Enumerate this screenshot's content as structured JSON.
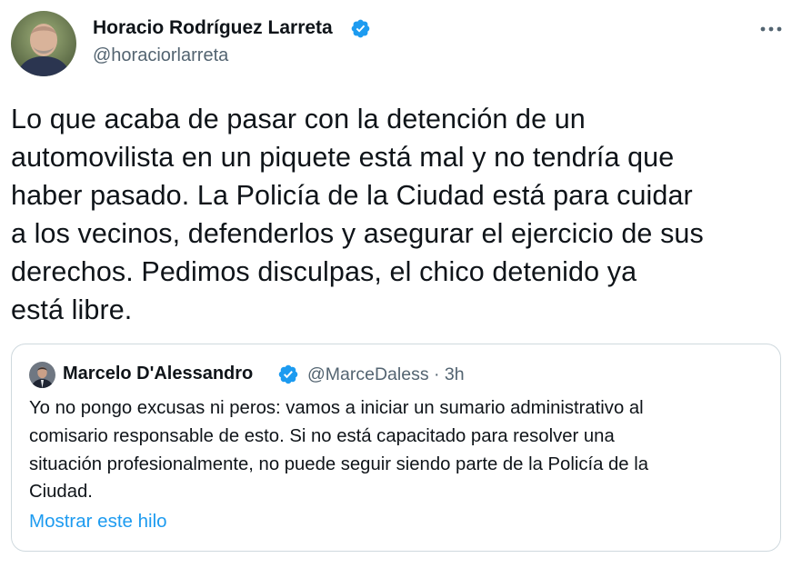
{
  "tweet": {
    "author": {
      "name": "Horacio Rodríguez Larreta",
      "handle": "@horaciorlarreta",
      "verified": true
    },
    "text": "Lo que acaba de pasar con la detención de un\nautomovilista en un piquete está mal y no tendría que\nhaber pasado. La Policía de la Ciudad está para cuidar\na los vecinos, defenderlos y asegurar el ejercicio de sus\nderechos. Pedimos disculpas, el chico detenido ya\nestá libre.",
    "more_icon": "more-horizontal-icon"
  },
  "quote": {
    "author": {
      "name": "Marcelo D'Alessandro",
      "handle": "@MarceDaless",
      "verified": true
    },
    "separator": "·",
    "time": "3h",
    "text": "Yo no pongo excusas ni peros: vamos a iniciar un sumario administrativo al\ncomisario responsable de esto. Si no está capacitado para resolver una\nsituación profesionalmente, no puede seguir siendo parte de la Policía de la\nCiudad.",
    "show_thread_label": "Mostrar este hilo"
  },
  "colors": {
    "verified_blue": "#1d9bf0",
    "link_blue": "#1d9bf0",
    "text_primary": "#0f1419",
    "text_secondary": "#536471",
    "border": "#cfd9de"
  }
}
